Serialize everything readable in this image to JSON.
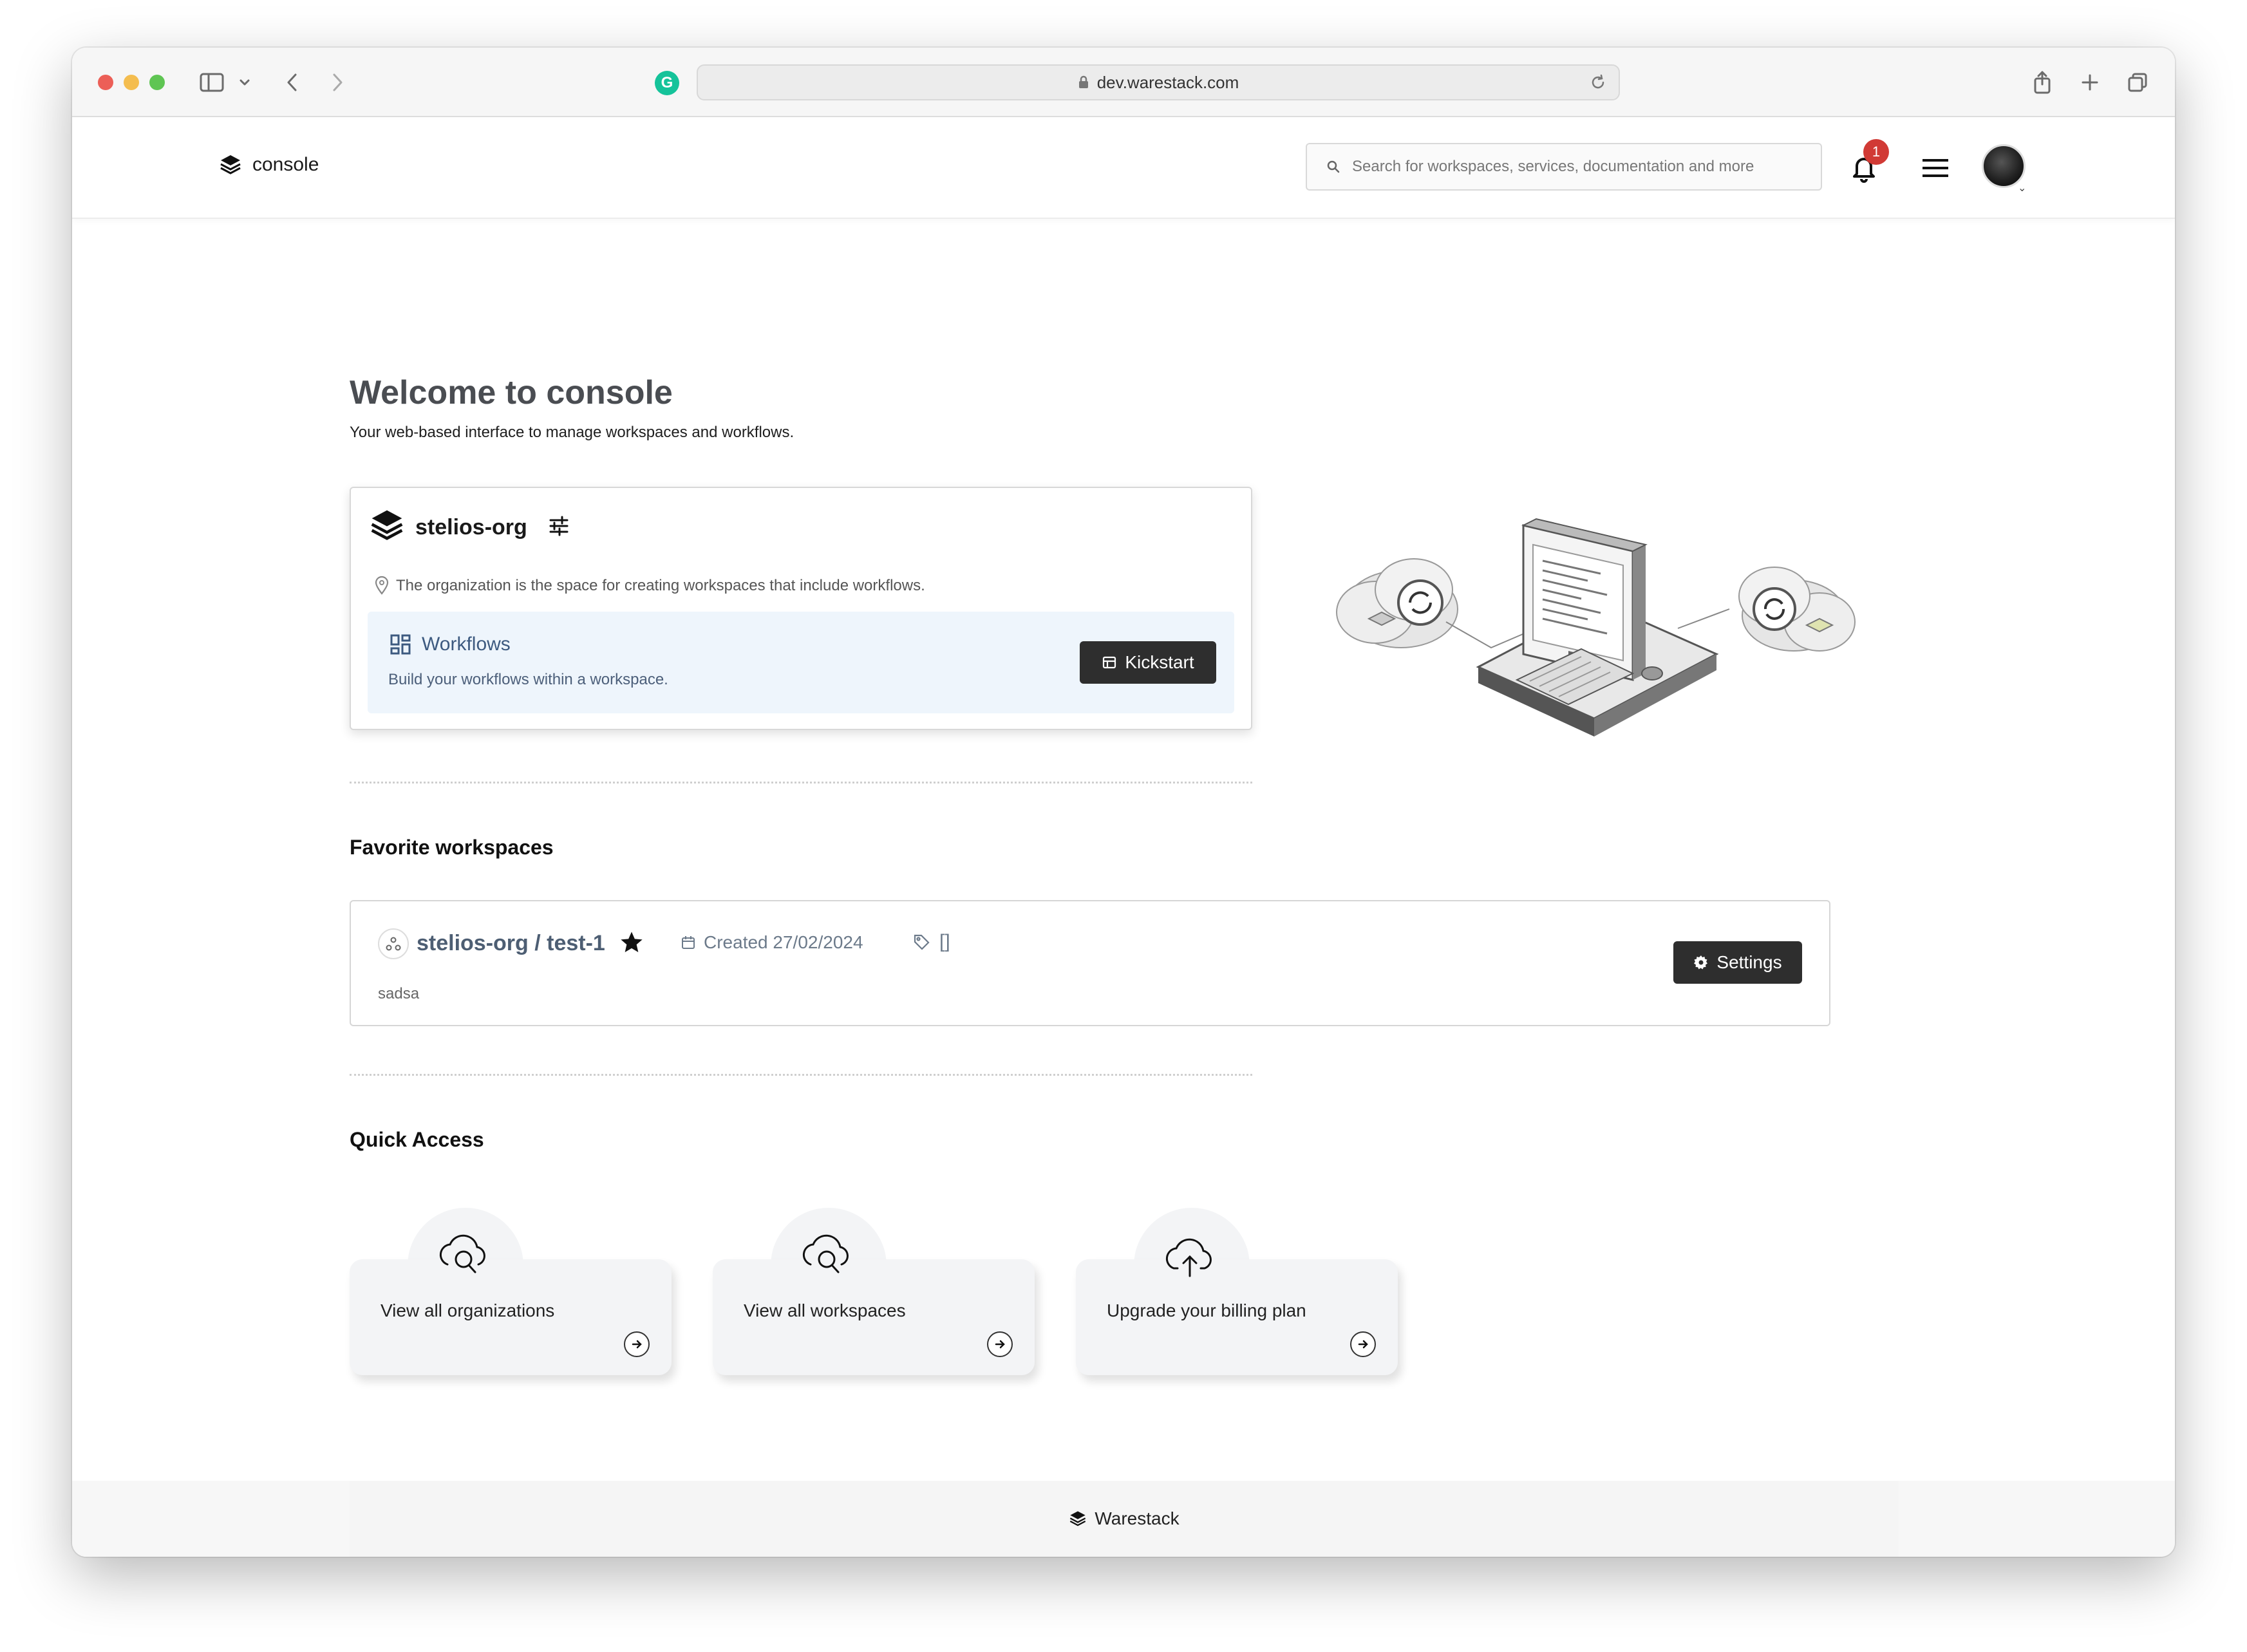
{
  "browser": {
    "url": "dev.warestack.com"
  },
  "header": {
    "brand": "console",
    "search_placeholder": "Search for workspaces, services, documentation and more",
    "notification_count": "1"
  },
  "welcome": {
    "title": "Welcome to console",
    "subtitle": "Your web-based interface to manage workspaces and workflows."
  },
  "org_card": {
    "name": "stelios-org",
    "description": "The organization is the space for creating workspaces that include workflows.",
    "workflows_title": "Workflows",
    "workflows_subtitle": "Build your workflows within a workspace.",
    "kickstart_label": "Kickstart"
  },
  "favorites": {
    "title": "Favorite workspaces",
    "items": [
      {
        "name": "stelios-org / test-1",
        "created": "Created 27/02/2024",
        "tags": "[]",
        "description": "sadsa",
        "settings_label": "Settings"
      }
    ]
  },
  "quick_access": {
    "title": "Quick Access",
    "items": [
      {
        "label": "View all organizations",
        "icon": "cloud-search-icon"
      },
      {
        "label": "View all workspaces",
        "icon": "cloud-search-icon"
      },
      {
        "label": "Upgrade your billing plan",
        "icon": "cloud-upload-icon"
      }
    ]
  },
  "footer": {
    "brand": "Warestack"
  }
}
